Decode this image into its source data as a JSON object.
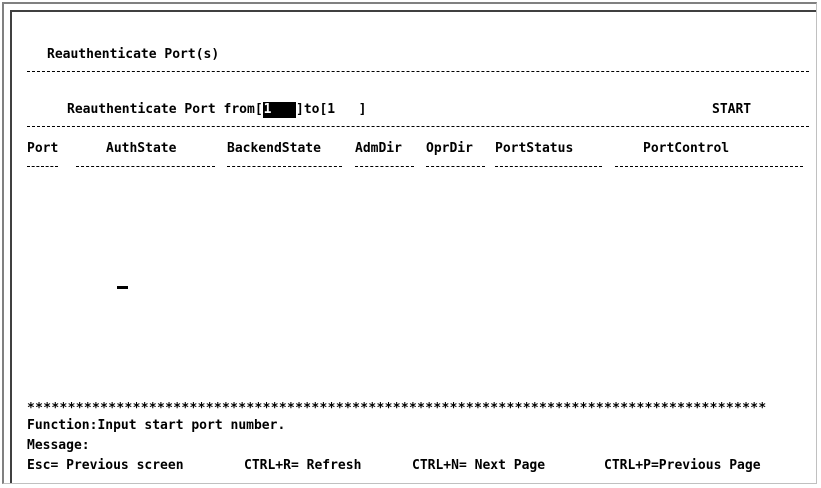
{
  "screen": {
    "title": "Reauthenticate Port(s)",
    "range": {
      "label_from": "Reauthenticate Port from",
      "from_value": "1",
      "label_to": "to",
      "to_value": "1",
      "start_label": "START"
    },
    "columns": [
      "Port",
      "AuthState",
      "BackendState",
      "AdmDir",
      "OprDir",
      "PortStatus",
      "PortControl"
    ],
    "separator_stars": "*******************************************************************************************",
    "function_text": "Function:Input start port number.",
    "message_label": "Message:",
    "footer_keys": [
      "Esc= Previous screen",
      "CTRL+R= Refresh",
      "CTRL+N= Next Page",
      "CTRL+P=Previous Page"
    ]
  }
}
